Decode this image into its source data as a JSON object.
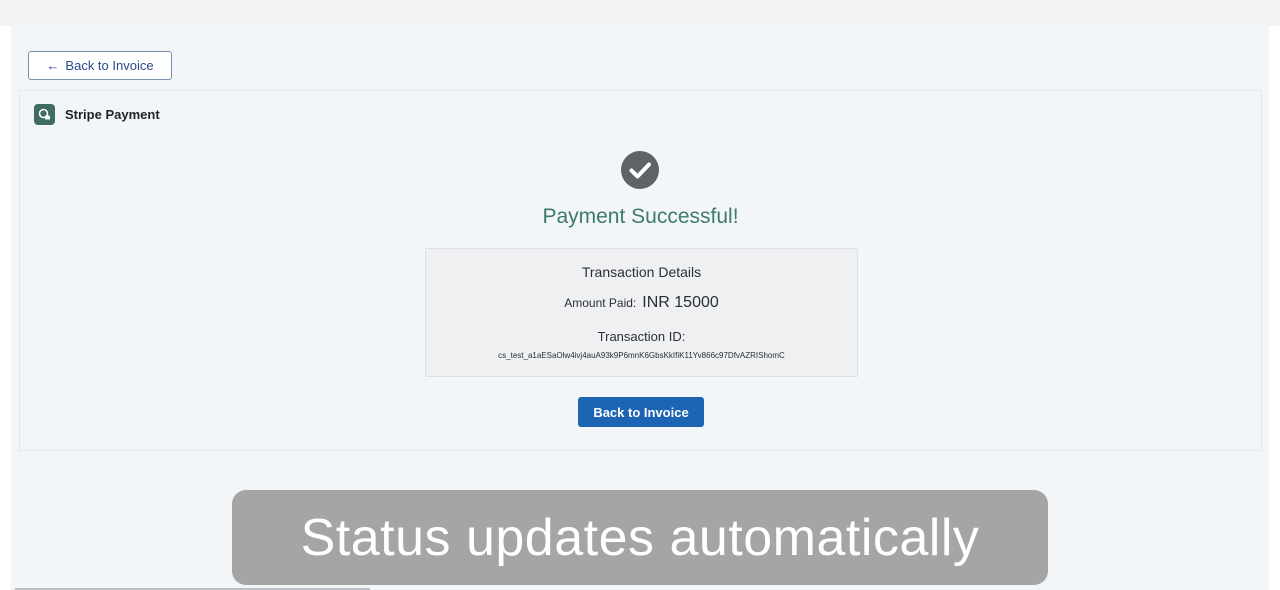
{
  "nav": {
    "back_label": "Back to Invoice",
    "back_arrow": "←"
  },
  "card": {
    "title": "Stripe Payment",
    "icon": "stripe-card-icon"
  },
  "status": {
    "icon": "check-circle-icon",
    "title": "Payment Successful!"
  },
  "transaction": {
    "heading": "Transaction Details",
    "amount_label": "Amount Paid:",
    "amount_value": "INR 15000",
    "id_label": "Transaction ID:",
    "id_value": "cs_test_a1aESaOlw4ivj4auA93k9P6mnK6GbsKkIfiK11Yv866c97DfvAZRIShomC"
  },
  "actions": {
    "primary_label": "Back to Invoice"
  },
  "caption": {
    "text": "Status updates automatically"
  },
  "colors": {
    "accent": "#1e64b4",
    "success": "#3c7a6c",
    "icon_bg": "#3e6b63",
    "check_circle": "#5f6368"
  }
}
